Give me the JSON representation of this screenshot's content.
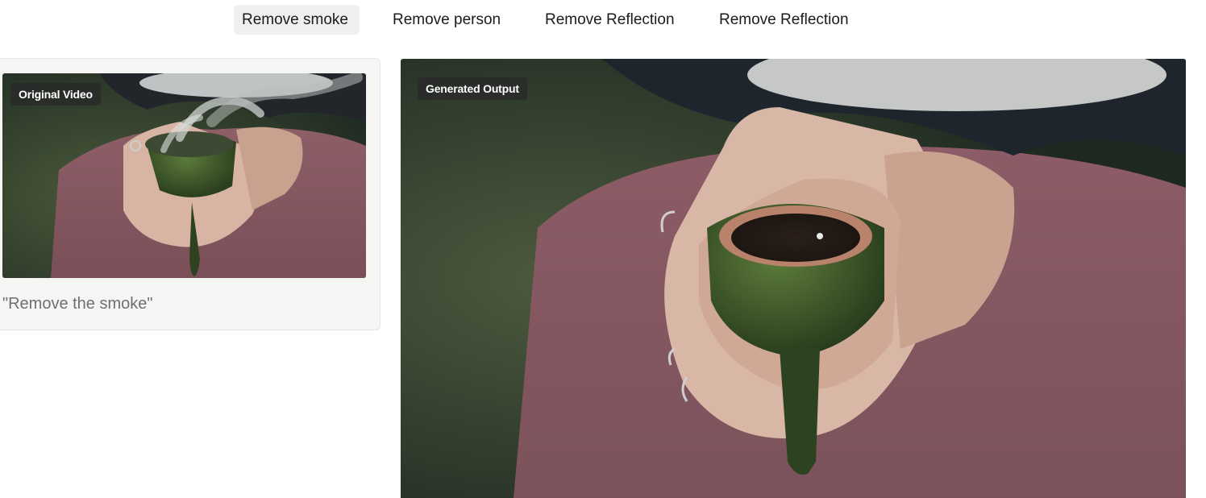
{
  "tabs": [
    {
      "label": "Remove smoke",
      "active": true
    },
    {
      "label": "Remove person",
      "active": false
    },
    {
      "label": "Remove Reflection",
      "active": false
    },
    {
      "label": "Remove Reflection",
      "active": false
    }
  ],
  "original": {
    "badge": "Original Video",
    "caption": "\"Remove the smoke\""
  },
  "output": {
    "badge": "Generated Output"
  },
  "colors": {
    "active_tab_bg": "#eef0f0",
    "card_bg": "#f5f5f4",
    "badge_bg": "#282828"
  }
}
